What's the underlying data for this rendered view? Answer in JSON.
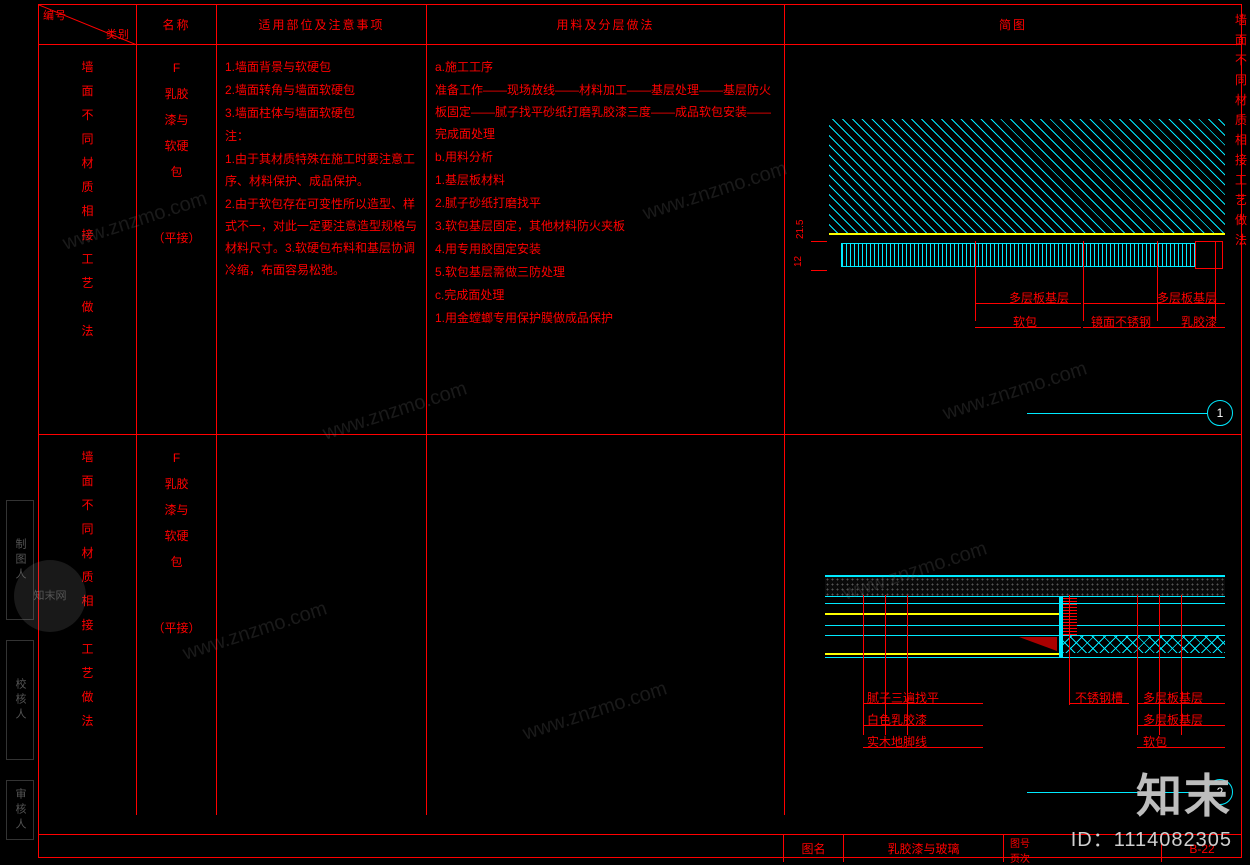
{
  "header": {
    "diag_top": "编号",
    "diag_bottom": "类别",
    "name": "名称",
    "note": "适用部位及注意事项",
    "method": "用料及分层做法",
    "diagram": "简图"
  },
  "right_title": "墙面不同材质相接工艺做法",
  "left_strips": {
    "a": "制图人",
    "b": "校核人",
    "c": "审核人"
  },
  "rows": [
    {
      "category": "墙面不同材质相接工艺做法",
      "name_main": "F\n乳胶\n漆与\n软硬\n包",
      "name_sub": "（平接）",
      "notes": [
        "1.墙面背景与软硬包",
        "2.墙面转角与墙面软硬包",
        "3.墙面柱体与墙面软硬包",
        "注：",
        "1.由于其材质特殊在施工时要注意工序、材料保护、成品保护。",
        "2.由于软包存在可变性所以造型、样式不一，对此一定要注意造型规格与材料尺寸。3.软硬包布料和基层协调冷缩，布面容易松弛。"
      ],
      "methods": [
        "a.施工工序",
        "准备工作——现场放线——材料加工——基层处理——基层防火板固定——腻子找平砂纸打磨乳胶漆三度——成品软包安装——完成面处理",
        "b.用料分析",
        "1.基层板材料",
        "2.腻子砂纸打磨找平",
        "3.软包基层固定，其他材料防火夹板",
        "4.用专用胶固定安装",
        "5.软包基层需做三防处理",
        "c.完成面处理",
        "1.用金螳螂专用保护膜做成品保护"
      ],
      "diagram": {
        "dim1": "21.5",
        "dim2": "12",
        "labels": {
          "a": "多层板基层",
          "b": "多层板基层",
          "c": "软包",
          "d": "镜面不锈钢",
          "e": "乳胶漆"
        },
        "marker": "1"
      }
    },
    {
      "category": "墙面不同材质相接工艺做法",
      "name_main": "F\n乳胶\n漆与\n软硬\n包",
      "name_sub": "（平接）",
      "notes": [],
      "methods": [],
      "diagram": {
        "left_labels": {
          "a": "腻子三遍找平",
          "b": "白色乳胶漆",
          "c": "实木地脚线"
        },
        "mid_label": "不锈钢槽",
        "right_labels": {
          "a": "多层板基层",
          "b": "多层板基层",
          "c": "软包"
        },
        "marker": "2"
      }
    }
  ],
  "footer": {
    "tuming": "图名",
    "tuming_val": "乳胶漆与玻璃",
    "tuhao": "图号",
    "yeci": "页次",
    "code": "B-22"
  },
  "watermark": {
    "url": "www.znzmo.com",
    "brand": "知末",
    "logo": "知末网",
    "id": "ID：1114082305"
  }
}
